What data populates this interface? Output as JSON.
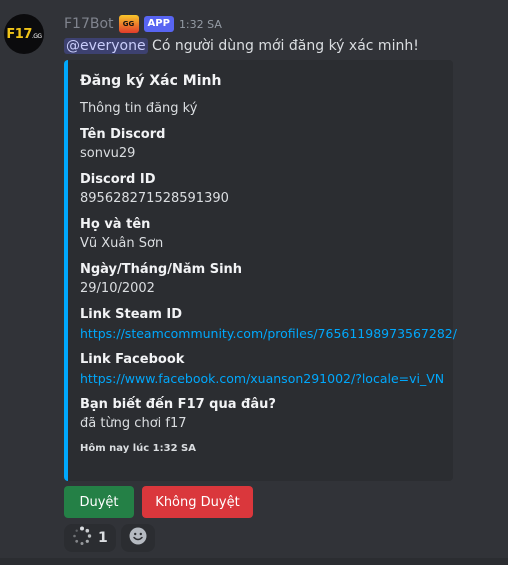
{
  "avatar": {
    "text_main": "F17",
    "text_suffix": ".GG"
  },
  "header": {
    "username": "F17Bot",
    "badge_icon_text": "GG",
    "app_tag": "APP",
    "timestamp": "1:32 SA"
  },
  "message": {
    "mention": "@everyone",
    "text": " Có người dùng mới đăng ký xác minh!"
  },
  "embed": {
    "accent_color": "#00a8fc",
    "title": "Đăng ký Xác Minh",
    "description": "Thông tin đăng ký",
    "fields": [
      {
        "name": "Tên Discord",
        "value": "sonvu29"
      },
      {
        "name": "Discord ID",
        "value": "895628271528591390"
      },
      {
        "name": "Họ và tên",
        "value": "Vũ Xuân Sơn"
      },
      {
        "name": "Ngày/Tháng/Năm Sinh",
        "value": "29/10/2002"
      },
      {
        "name": "Link Steam ID",
        "value": "https://steamcommunity.com/profiles/76561198973567282/"
      },
      {
        "name": "Link Facebook",
        "value": "https://www.facebook.com/xuanson291002/?locale=vi_VN"
      },
      {
        "name": "Bạn biết đến F17 qua đâu?",
        "value": "đã từng chơi f17"
      }
    ],
    "footer": "Hôm nay lúc 1:32 SA"
  },
  "buttons": {
    "approve": "Duyệt",
    "reject": "Không Duyệt",
    "approve_color": "#248046",
    "reject_color": "#da373c"
  },
  "reactions": {
    "loading_count": "1",
    "loading_icon": "loading-spinner-icon",
    "add_icon": "add-reaction-smile-icon"
  }
}
